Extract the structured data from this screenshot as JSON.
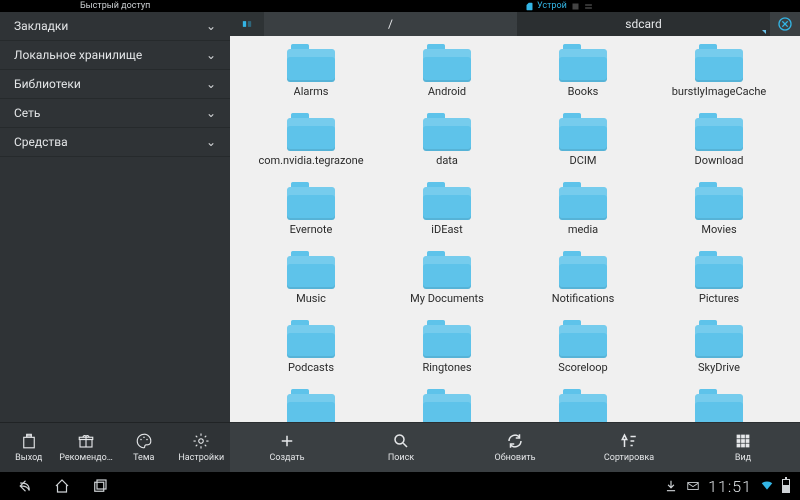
{
  "topstrip": {
    "quick_access": "Быстрый доступ",
    "device_label": "Устрой"
  },
  "sidebar": {
    "items": [
      {
        "label": "Закладки"
      },
      {
        "label": "Локальное хранилище"
      },
      {
        "label": "Библиотеки"
      },
      {
        "label": "Сеть"
      },
      {
        "label": "Средства"
      }
    ],
    "bottom": [
      {
        "label": "Выход"
      },
      {
        "label": "Рекомендов…"
      },
      {
        "label": "Тема"
      },
      {
        "label": "Настройки"
      }
    ]
  },
  "pathbar": {
    "root": "/",
    "current": "sdcard"
  },
  "folders": [
    {
      "name": "Alarms"
    },
    {
      "name": "Android"
    },
    {
      "name": "Books"
    },
    {
      "name": "burstlyImageCache"
    },
    {
      "name": "com.nvidia.tegrazone"
    },
    {
      "name": "data"
    },
    {
      "name": "DCIM"
    },
    {
      "name": "Download"
    },
    {
      "name": "Evernote"
    },
    {
      "name": "iDEast"
    },
    {
      "name": "media"
    },
    {
      "name": "Movies"
    },
    {
      "name": "Music"
    },
    {
      "name": "My Documents"
    },
    {
      "name": "Notifications"
    },
    {
      "name": "Pictures"
    },
    {
      "name": "Podcasts"
    },
    {
      "name": "Ringtones"
    },
    {
      "name": "Scoreloop"
    },
    {
      "name": "SkyDrive"
    }
  ],
  "folders_cut": [
    {
      "name": ""
    },
    {
      "name": ""
    },
    {
      "name": ""
    },
    {
      "name": ""
    }
  ],
  "toolbar": [
    {
      "label": "Создать"
    },
    {
      "label": "Поиск"
    },
    {
      "label": "Обновить"
    },
    {
      "label": "Сортировка"
    },
    {
      "label": "Вид"
    }
  ],
  "statusbar": {
    "time": "11:51"
  }
}
